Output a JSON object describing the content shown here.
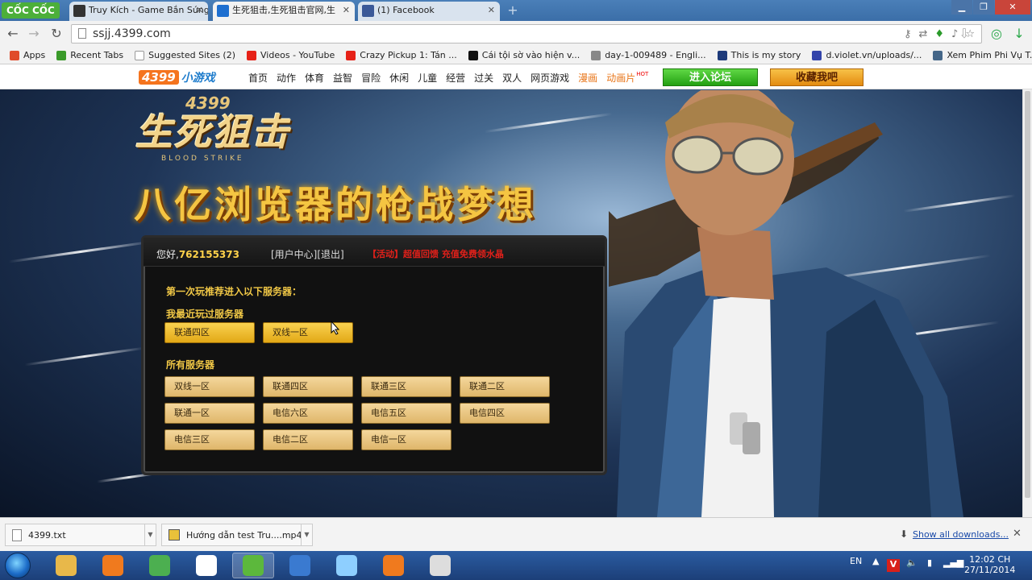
{
  "browser": {
    "brand": "CỐC CỐC",
    "tabs": [
      {
        "title": "Truy Kích - Game Bắn Súng",
        "favicon": "game-icon",
        "color": "#333333",
        "active": false
      },
      {
        "title": "生死狙击,生死狙击官网,生",
        "favicon": "4399-icon",
        "color": "#1e6fd0",
        "active": true
      },
      {
        "title": "(1) Facebook",
        "favicon": "facebook-icon",
        "color": "#3b5998",
        "active": false
      }
    ],
    "url": "ssjj.4399.com",
    "bookmarks": [
      {
        "label": "Apps",
        "icon": "apps-grid-icon",
        "color": "#e04b2a"
      },
      {
        "label": "Recent Tabs",
        "icon": "recent-tabs-icon",
        "color": "#3a9a2a"
      },
      {
        "label": "Suggested Sites (2)",
        "icon": "page-icon",
        "color": "#ffffff"
      },
      {
        "label": "Videos - YouTube",
        "icon": "youtube-icon",
        "color": "#e62117"
      },
      {
        "label": "Crazy Pickup 1: Tán ...",
        "icon": "youtube-icon",
        "color": "#e62117"
      },
      {
        "label": "Cái tội sờ vào hiện v...",
        "icon": "c-icon",
        "color": "#111111"
      },
      {
        "label": "day-1-009489 - Engli...",
        "icon": "pen-icon",
        "color": "#888888"
      },
      {
        "label": "This is my story",
        "icon": "story-icon",
        "color": "#1d3a7a"
      },
      {
        "label": "d.violet.vn/uploads/...",
        "icon": "violet-icon",
        "color": "#3344aa"
      },
      {
        "label": "Xem Phim Phi Vụ T...",
        "icon": "film-icon",
        "color": "#446688"
      }
    ]
  },
  "site_nav": {
    "logo_number": "4399",
    "logo_text": "小游戏",
    "links": [
      "首页",
      "动作",
      "体育",
      "益智",
      "冒险",
      "休闲",
      "儿童",
      "经营",
      "过关",
      "双人",
      "网页游戏"
    ],
    "highlight_links": [
      "漫画",
      "动画片"
    ],
    "hot_badge": "HOT",
    "forum_button": "进入论坛",
    "favorite_button": "收藏我吧"
  },
  "hero": {
    "game_number": "4399",
    "game_title": "生死狙击",
    "game_subtitle": "BLOOD STRIKE",
    "slogan": "八亿浏览器的枪战梦想"
  },
  "panel": {
    "greeting": "您好,",
    "user_id": "762155373",
    "user_center": "[用户中心]",
    "logout": "[退出]",
    "promo": "【活动】超值回馈 充值免费领水晶",
    "prompt": "第一次玩推荐进入以下服务器：",
    "recent_title": "我最近玩过服务器",
    "recent_servers": [
      "联通四区",
      "双线一区"
    ],
    "all_title": "所有服务器",
    "all_servers": [
      "双线一区",
      "联通四区",
      "联通三区",
      "联通二区",
      "联通一区",
      "电信六区",
      "电信五区",
      "电信四区",
      "电信三区",
      "电信二区",
      "电信一区"
    ]
  },
  "downloads": {
    "items": [
      {
        "name": "4399.txt",
        "icon": "text-file-icon"
      },
      {
        "name": "Hướng dẫn test Tru....mp4",
        "icon": "video-file-icon"
      }
    ],
    "show_all": "Show all downloads..."
  },
  "taskbar": {
    "apps": [
      {
        "name": "file-explorer-icon",
        "color": "#e8b84a"
      },
      {
        "name": "xampp-icon",
        "color": "#f07a1e"
      },
      {
        "name": "chrome-icon",
        "color": "#4caf50"
      },
      {
        "name": "opera-icon",
        "color": "#ffffff"
      },
      {
        "name": "coccoc-icon",
        "color": "#5cb83c"
      },
      {
        "name": "media-player-icon",
        "color": "#3a7ad0"
      },
      {
        "name": "notepad-icon",
        "color": "#8ecfff"
      },
      {
        "name": "video-player-icon",
        "color": "#f07a1e"
      },
      {
        "name": "film-reel-icon",
        "color": "#dddddd"
      }
    ],
    "language": "EN",
    "time": "12:02 CH",
    "date": "27/11/2014"
  }
}
